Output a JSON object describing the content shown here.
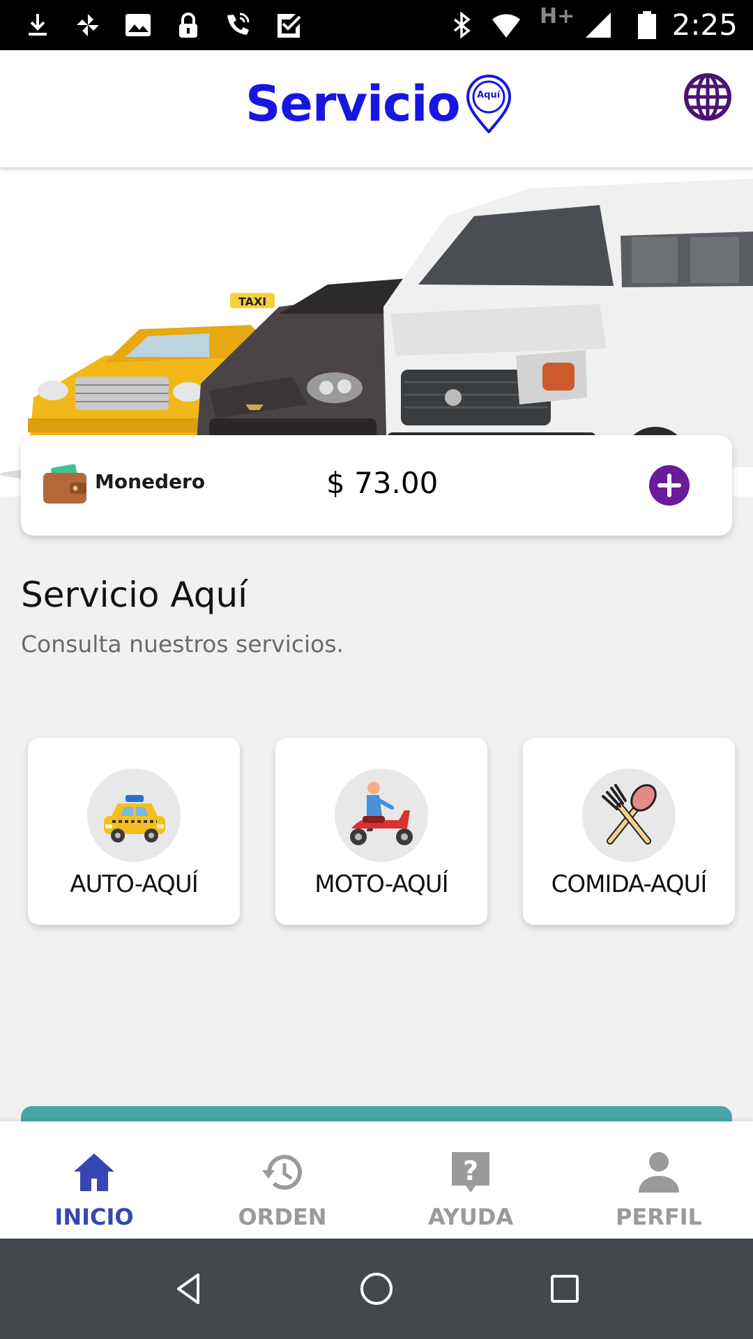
{
  "status_bar": {
    "time": "2:25",
    "network_label": "H+",
    "icons": [
      "download-icon",
      "pinwheel-icon",
      "image-icon",
      "lock-icon",
      "wifi-calling-icon",
      "checkbox-icon",
      "bluetooth-icon",
      "wifi-icon",
      "signal-icon",
      "battery-icon"
    ]
  },
  "header": {
    "logo_text": "Servicio",
    "logo_pin_text": "Aquí",
    "globe_icon": "globe-icon"
  },
  "banner": {
    "taxi_sign": "TAXI"
  },
  "wallet": {
    "label": "Monedero",
    "amount": "$ 73.00",
    "icon": "wallet-icon",
    "add_icon": "plus-circle-icon",
    "accent": "#6a1b9a"
  },
  "section": {
    "title": "Servicio Aquí",
    "subtitle": "Consulta nuestros servicios."
  },
  "services": [
    {
      "label": "AUTO-AQUÍ",
      "icon": "taxi-icon"
    },
    {
      "label": "MOTO-AQUÍ",
      "icon": "scooter-icon"
    },
    {
      "label": "COMIDA-AQUÍ",
      "icon": "fork-spoon-icon"
    }
  ],
  "bottom_nav": {
    "items": [
      {
        "label": "INICIO",
        "icon": "home-icon",
        "active": true
      },
      {
        "label": "ORDEN",
        "icon": "history-icon",
        "active": false
      },
      {
        "label": "AYUDA",
        "icon": "help-icon",
        "active": false
      },
      {
        "label": "PERFIL",
        "icon": "person-icon",
        "active": false
      }
    ],
    "active_color": "#3746b2",
    "inactive_color": "#9a9a9a"
  },
  "system_nav": {
    "icons": [
      "back-icon",
      "home-circle-icon",
      "recents-icon"
    ]
  }
}
